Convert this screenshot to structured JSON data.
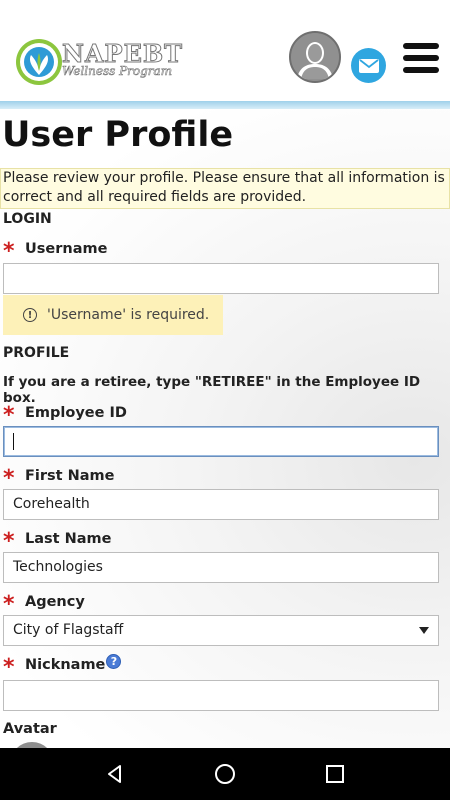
{
  "header": {
    "logo": {
      "title": "NAPEBT",
      "subtitle": "Wellness Program"
    },
    "icons": {
      "avatar": "user-silhouette-icon",
      "mail": "mail-icon",
      "menu": "hamburger-menu-icon"
    },
    "colors": {
      "mail_button": "#2fa6e0",
      "header_rule": "#9fd0ea"
    }
  },
  "page": {
    "title": "User Profile",
    "notice": "Please review your profile. Please ensure that all information is correct and all required fields are provided."
  },
  "login": {
    "section_label": "LOGIN",
    "username_label": "Username",
    "username_value": "",
    "username_error": "'Username' is required."
  },
  "profile": {
    "section_label": "PROFILE",
    "retiree_hint": "If you are a retiree, type \"RETIREE\" in the Employee ID box.",
    "employee_id_label": "Employee ID",
    "employee_id_value": "",
    "first_name_label": "First Name",
    "first_name_value": "Corehealth",
    "last_name_label": "Last Name",
    "last_name_value": "Technologies",
    "agency_label": "Agency",
    "agency_value": "City of Flagstaff",
    "nickname_label": "Nickname",
    "nickname_value": "",
    "avatar_label": "Avatar"
  },
  "required_marker": "*",
  "nav": {
    "back": "back-icon",
    "home": "home-icon",
    "recents": "recents-icon"
  }
}
